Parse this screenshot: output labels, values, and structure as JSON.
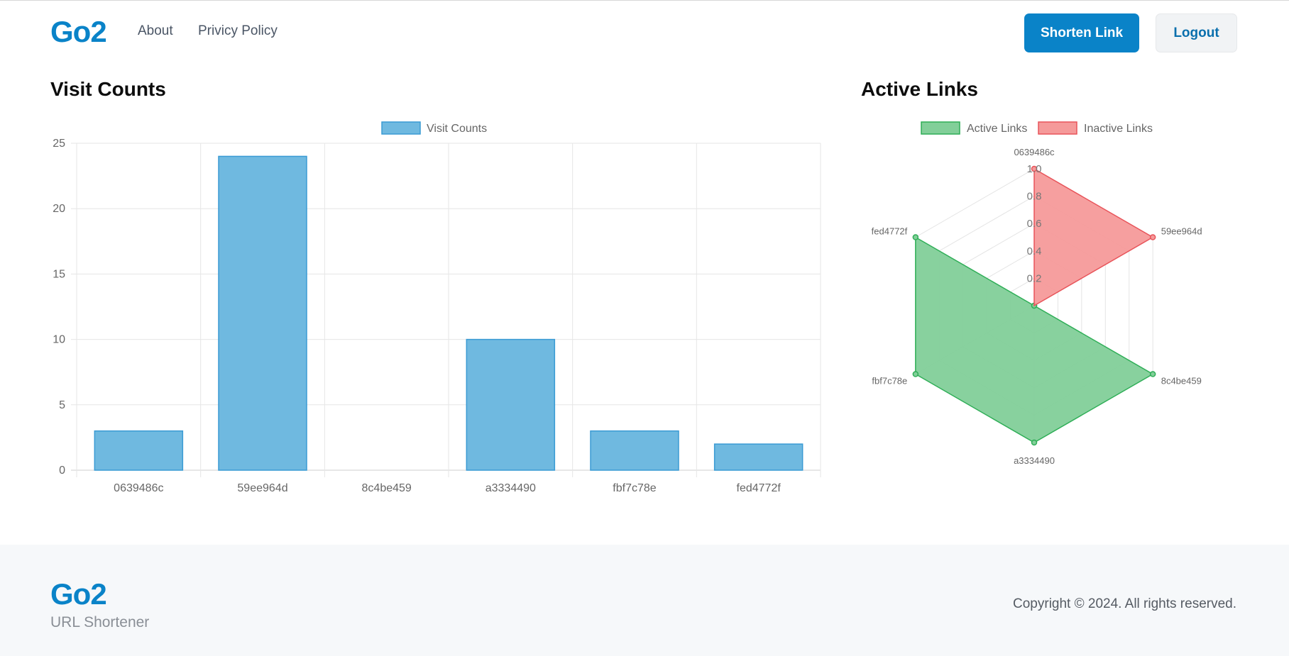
{
  "header": {
    "logo": "Go2",
    "nav": [
      "About",
      "Privicy Policy"
    ],
    "shorten_label": "Shorten Link",
    "logout_label": "Logout"
  },
  "sections": {
    "visits_title": "Visit Counts",
    "active_title": "Active Links"
  },
  "colors": {
    "brand": "#0a83c8",
    "bar_fill": "#6fb9e0",
    "bar_stroke": "#3a9bd4",
    "active_fill": "#82cf99",
    "active_stroke": "#2fae57",
    "inactive_fill": "#f59a9a",
    "inactive_stroke": "#e8545a"
  },
  "chart_data": [
    {
      "type": "bar",
      "categories": [
        "0639486c",
        "59ee964d",
        "8c4be459",
        "a3334490",
        "fbf7c78e",
        "fed4772f"
      ],
      "series": [
        {
          "name": "Visit Counts",
          "values": [
            3,
            24,
            0,
            10,
            3,
            2
          ]
        }
      ],
      "ylim": [
        0,
        25
      ],
      "yticks": [
        0,
        5,
        10,
        15,
        20,
        25
      ],
      "grid": true,
      "legend": "top-center"
    },
    {
      "type": "radar",
      "categories": [
        "0639486c",
        "59ee964d",
        "8c4be459",
        "a3334490",
        "fbf7c78e",
        "fed4772f"
      ],
      "series": [
        {
          "name": "Active Links",
          "values": [
            0,
            0,
            1,
            1,
            1,
            1
          ]
        },
        {
          "name": "Inactive Links",
          "values": [
            1,
            1,
            0,
            0,
            0,
            0
          ]
        }
      ],
      "rlim": [
        0,
        1
      ],
      "rticks": [
        "0.2",
        "0.4",
        "0.6",
        "0.8",
        "1.0"
      ],
      "legend": "top-center"
    }
  ],
  "footer": {
    "logo": "Go2",
    "tagline": "URL Shortener",
    "copyright": "Copyright © 2024. All rights reserved."
  }
}
